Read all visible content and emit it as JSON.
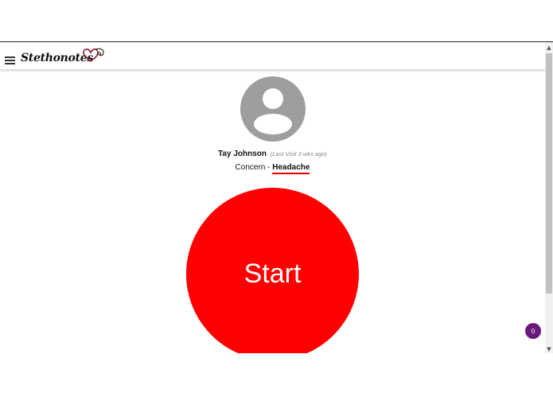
{
  "app": {
    "logo_text": "Stethonotes"
  },
  "patient": {
    "name": "Tay Johnson",
    "last_visit": "(Last Visit 3 wks ago)"
  },
  "concern": {
    "label": "Concern - ",
    "value": "Headache"
  },
  "start_button": {
    "label": "Start"
  },
  "notification_badge": {
    "count": "0"
  },
  "icons": {
    "menu": "hamburger-menu-icon",
    "avatar": "user-avatar-icon",
    "logo_mark": "stethoscope-heart-icon",
    "scroll_up": "chevron-up-icon",
    "scroll_down": "chevron-down-icon"
  },
  "colors": {
    "start_button": "#ff0000",
    "concern_underline": "#e50000",
    "badge": "#6b1a7c",
    "avatar": "#9e9e9e"
  }
}
